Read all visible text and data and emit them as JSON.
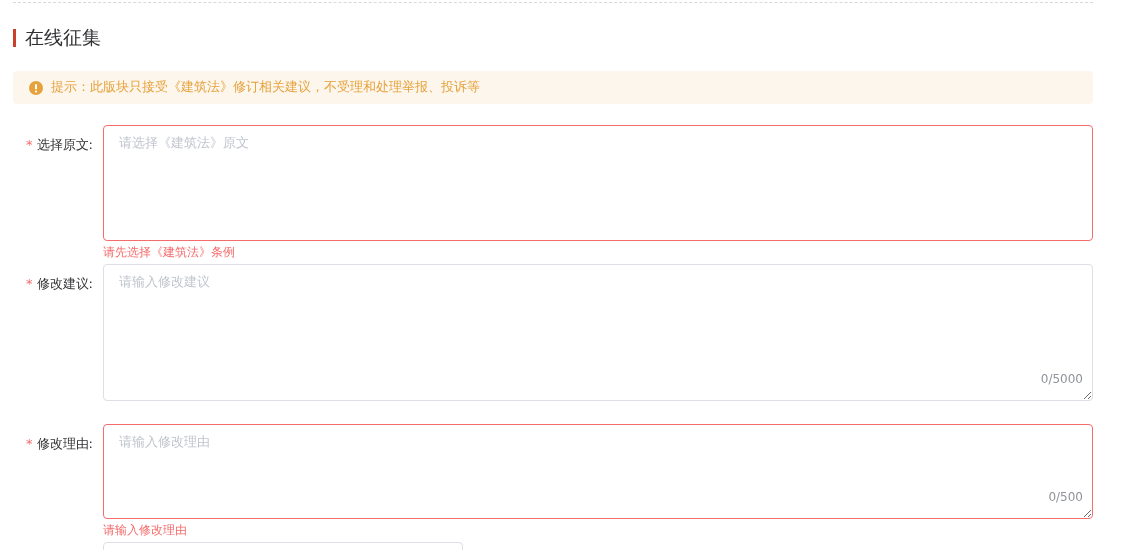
{
  "section": {
    "title": "在线征集"
  },
  "notice": {
    "text": "提示：此版块只接受《建筑法》修订相关建议，不受理和处理举报、投诉等"
  },
  "fields": [
    {
      "kind": "textarea",
      "required_mark": "*",
      "label": "选择原文:",
      "placeholder": "请选择《建筑法》原文",
      "invalid": true,
      "error": "请先选择《建筑法》条例",
      "resizable": false
    },
    {
      "kind": "textarea",
      "required_mark": "*",
      "label": "修改建议:",
      "placeholder": "请输入修改建议",
      "invalid": false,
      "counter": "0/5000",
      "resizable": true
    },
    {
      "kind": "textarea",
      "required_mark": "*",
      "label": "修改理由:",
      "placeholder": "请输入修改理由",
      "invalid": true,
      "counter": "0/500",
      "error": "请输入修改理由",
      "resizable": true
    },
    {
      "kind": "input",
      "invalid": false
    }
  ]
}
